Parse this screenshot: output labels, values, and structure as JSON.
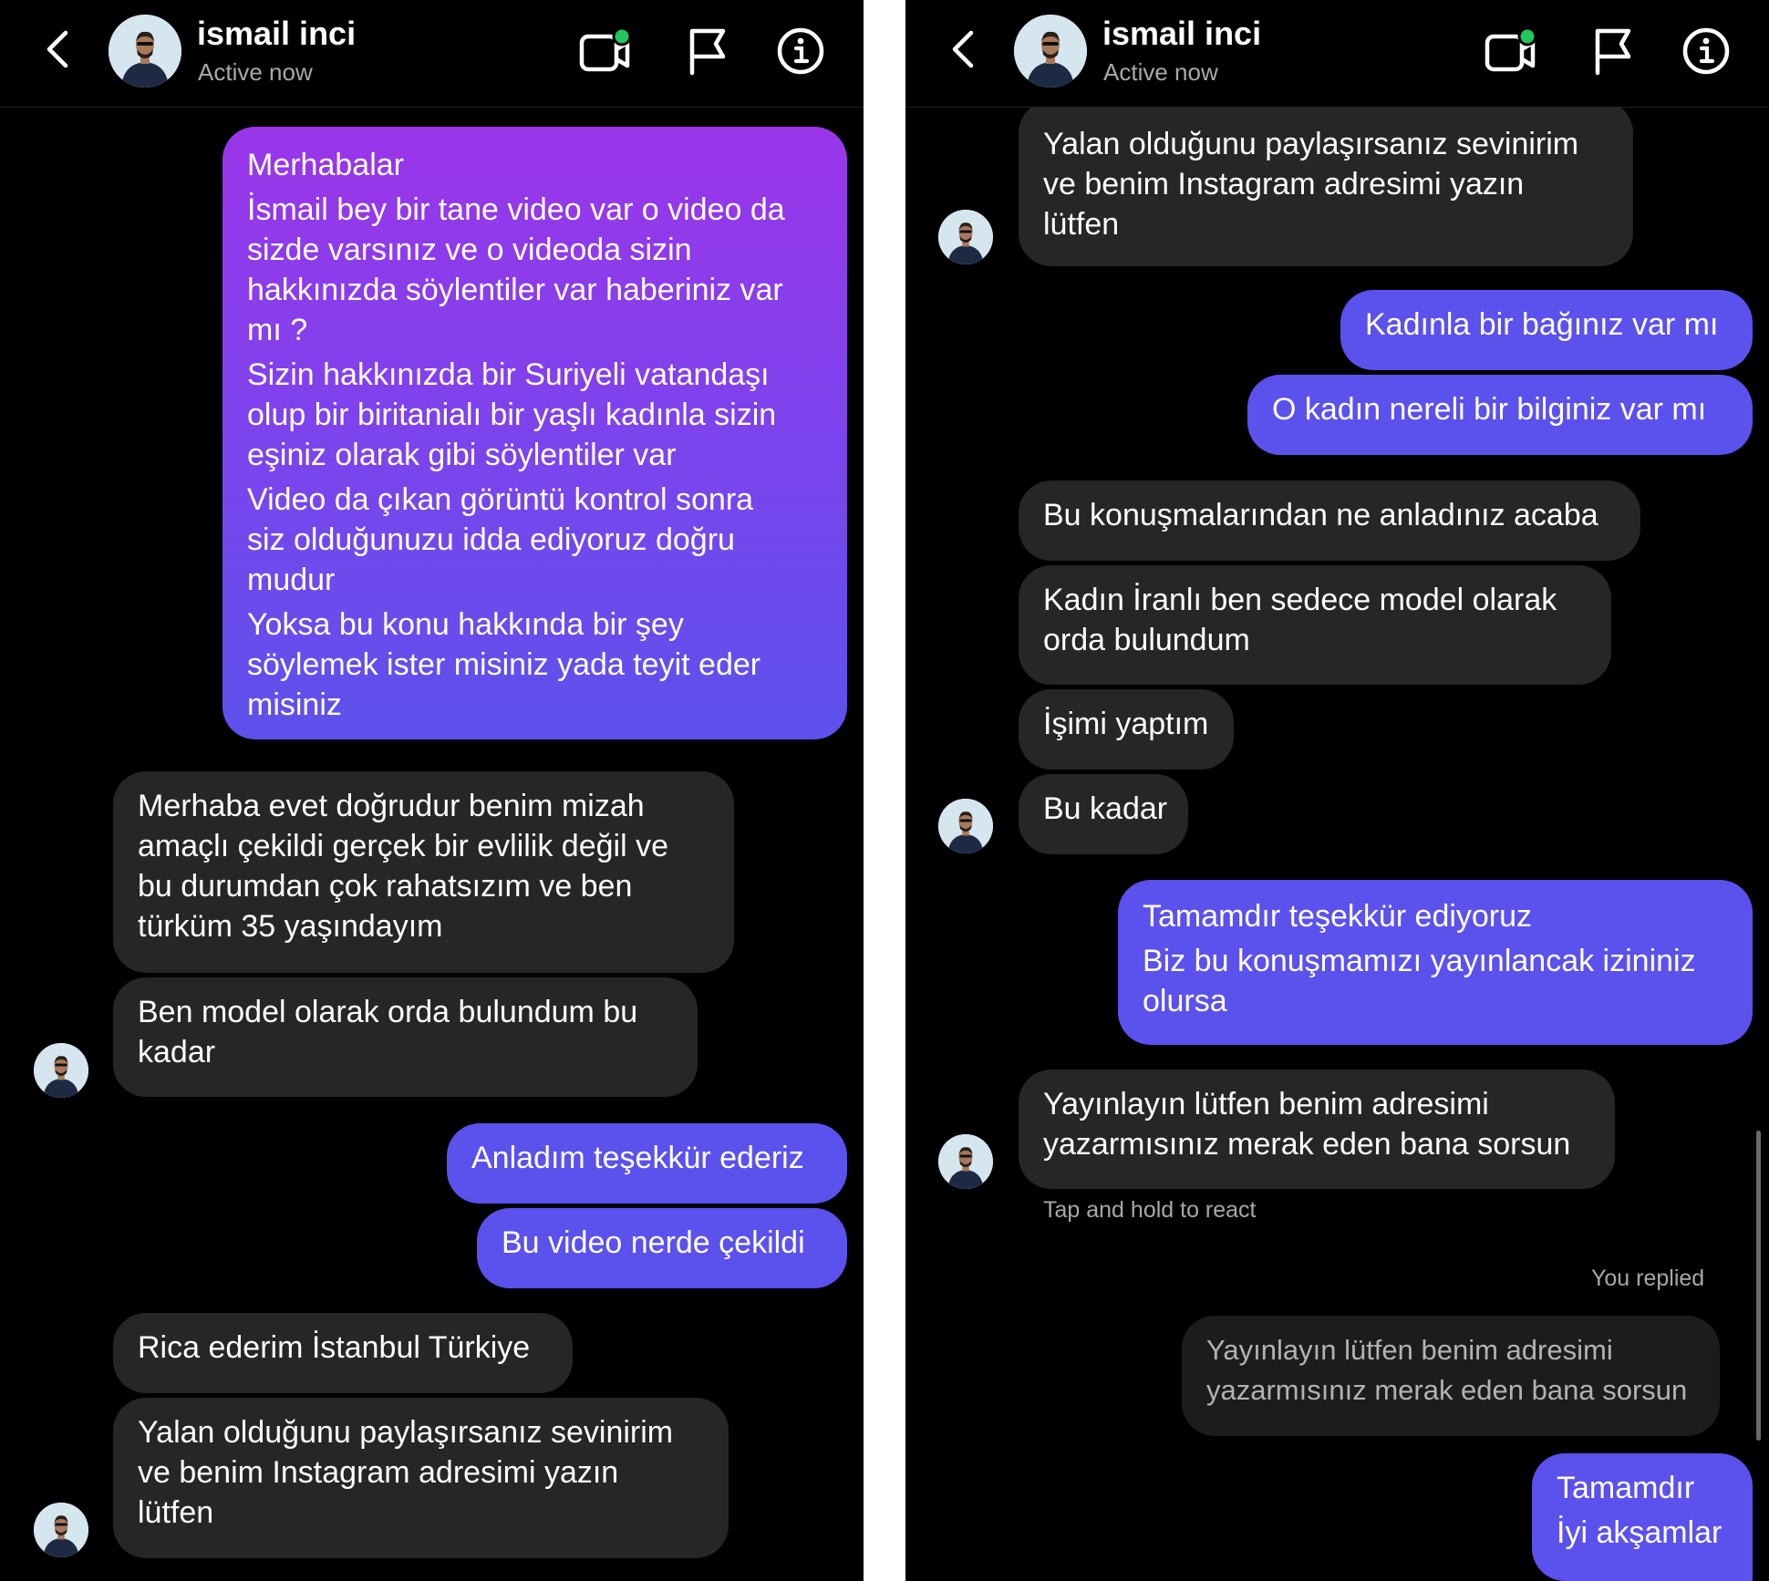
{
  "contact": {
    "name": "ismail inci",
    "status": "Active now"
  },
  "colors": {
    "incoming": "#262626",
    "outgoing": "#5b51ed",
    "gradient_top": "#9a35ea",
    "background": "#000000",
    "active_dot": "#22c55e"
  },
  "icons": [
    "back-chevron-icon",
    "video-call-icon",
    "flag-icon",
    "info-icon"
  ],
  "left": {
    "m1": {
      "lines": [
        "Merhabalar",
        "İsmail bey bir tane video var o video da",
        "sizde varsınız ve o videoda  sizin",
        "hakkınızda söylentiler var haberiniz var",
        "mı ?",
        "Sizin hakkınızda bir Suriyeli vatandaşı",
        "olup bir biritanialı bir yaşlı kadınla sizin",
        "eşiniz olarak gibi söylentiler var",
        "Video da çıkan görüntü kontrol sonra",
        "siz olduğunuzu idda ediyoruz doğru",
        "mudur",
        "Yoksa bu konu hakkında bir şey",
        "söylemek ister misiniz yada teyit eder",
        "misiniz"
      ]
    },
    "m2": {
      "lines": [
        "Merhaba evet doğrudur benim mizah",
        "amaçlı çekildi gerçek bir evlilik değil ve",
        "bu durumdan çok rahatsızım ve ben",
        "türküm 35 yaşındayım"
      ]
    },
    "m3": {
      "lines": [
        "Ben model olarak orda bulundum bu",
        "kadar"
      ]
    },
    "m4": {
      "text": "Anladım teşekkür ederiz"
    },
    "m5": {
      "text": "Bu video nerde çekildi"
    },
    "m6": {
      "text": "Rica ederim İstanbul Türkiye"
    },
    "m7": {
      "lines": [
        "Yalan olduğunu paylaşırsanız sevinirim",
        "ve benim Instagram adresimi yazın",
        "lütfen"
      ]
    }
  },
  "right": {
    "m1": {
      "lines": [
        "Yalan olduğunu paylaşırsanız sevinirim",
        "ve benim Instagram adresimi yazın",
        "lütfen"
      ]
    },
    "m2": {
      "text": "Kadınla bir bağınız var mı"
    },
    "m3": {
      "text": "O kadın nereli bir bilginiz var mı"
    },
    "m4": {
      "text": "Bu konuşmalarından ne anladınız acaba"
    },
    "m5": {
      "lines": [
        "Kadın İranlı ben sedece model olarak",
        "orda bulundum"
      ]
    },
    "m6": {
      "text": "İşimi yaptım"
    },
    "m7": {
      "text": "Bu kadar"
    },
    "m8": {
      "lines": [
        "Tamamdır teşekkür ediyoruz",
        "Biz bu konuşmamızı yayınlancak izininiz",
        "olursa"
      ]
    },
    "m9": {
      "lines": [
        "Yayınlayın lütfen benim adresimi",
        "yazarmısınız merak eden bana sorsun"
      ]
    },
    "tap_hint": "Tap and hold to react",
    "you_replied": "You replied",
    "reply_quote": {
      "lines": [
        "Yayınlayın lütfen benim adresimi",
        "yazarmısınız merak eden bana sorsun"
      ]
    },
    "m10": {
      "lines": [
        "Tamamdır",
        "İyi akşamlar"
      ]
    }
  }
}
